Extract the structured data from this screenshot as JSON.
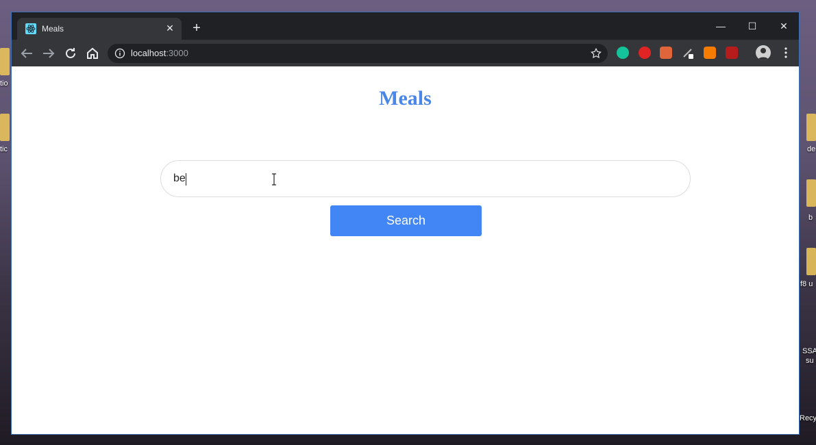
{
  "tab": {
    "title": "Meals"
  },
  "address_bar": {
    "host": "localhost",
    "port": ":3000"
  },
  "page": {
    "heading": "Meals",
    "search": {
      "value": "be"
    },
    "search_button_label": "Search"
  },
  "desktop": {
    "labels": [
      "tio",
      "tic",
      "de",
      "b",
      "f8 u",
      "SSA",
      "su",
      "Recy"
    ]
  },
  "colors": {
    "heading": "#4a86e8",
    "button": "#4285f4",
    "chrome_dark": "#202124",
    "chrome_toolbar": "#35363a"
  }
}
